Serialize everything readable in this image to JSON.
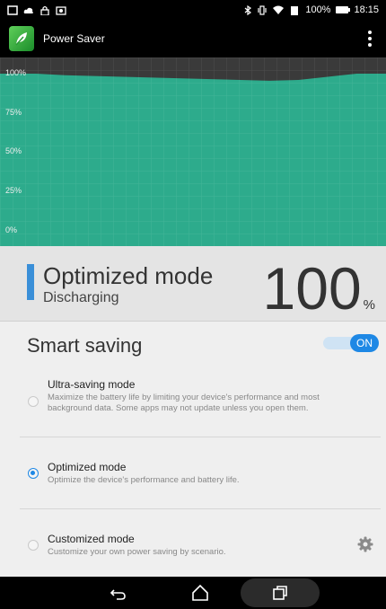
{
  "status_bar": {
    "battery_text": "100%",
    "time": "18:15"
  },
  "app": {
    "title": "Power Saver"
  },
  "chart": {
    "y_ticks": [
      "100%",
      "75%",
      "50%",
      "25%",
      "0%"
    ],
    "fill_color": "#2dab8c",
    "history_levels": [
      100,
      99,
      98.5,
      98,
      97.5,
      97,
      96.5,
      96,
      95.5,
      96,
      98,
      100,
      100
    ]
  },
  "mode_panel": {
    "title": "Optimized mode",
    "state": "Discharging",
    "battery_percent": "100",
    "percent_unit": "%",
    "accent_color": "#3a8fd8"
  },
  "smart_saving": {
    "title": "Smart saving",
    "toggle_label": "ON",
    "toggle_on": true,
    "options": [
      {
        "title": "Ultra-saving mode",
        "description": "Maximize the battery life by limiting your device's performance and most background data. Some apps may not update unless you open them.",
        "selected": false
      },
      {
        "title": "Optimized mode",
        "description": "Optimize the device's performance and battery life.",
        "selected": true
      },
      {
        "title": "Customized mode",
        "description": "Customize your own power saving by scenario.",
        "selected": false
      }
    ]
  },
  "nav": {
    "icons": [
      "back-icon",
      "home-icon",
      "recents-icon"
    ]
  }
}
